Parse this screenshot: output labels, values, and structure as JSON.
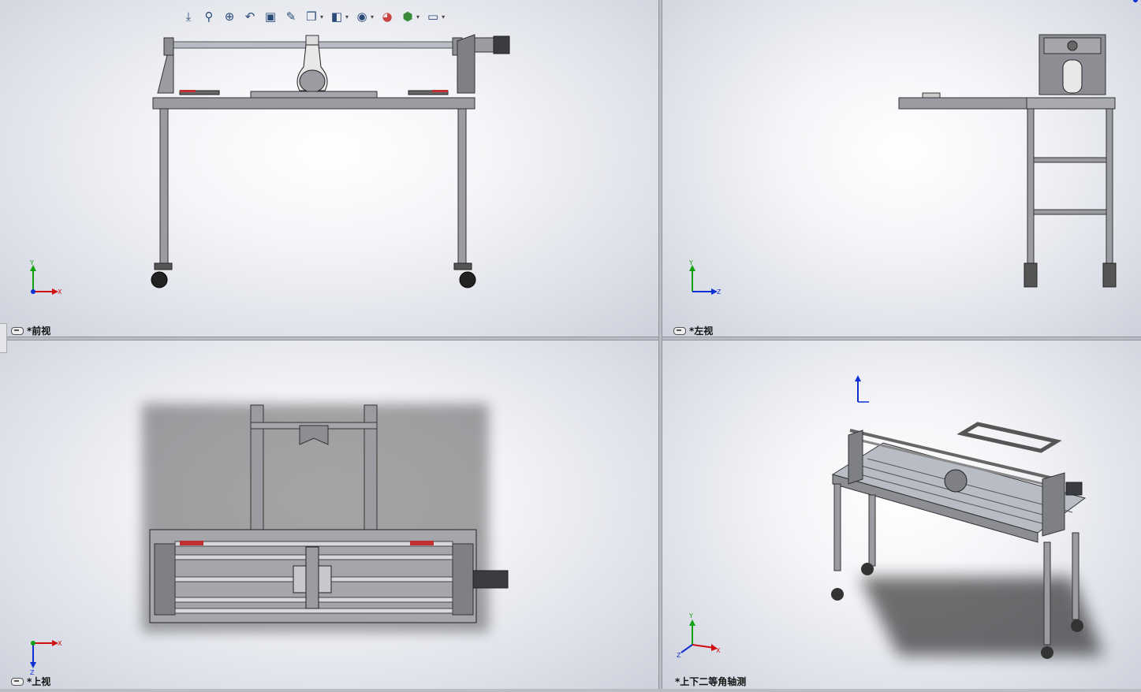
{
  "viewports": {
    "front": {
      "label": "*前视",
      "axes": {
        "up": "Y",
        "right": "X"
      }
    },
    "left": {
      "label": "*左视",
      "axes": {
        "up": "Y",
        "right": "Z"
      }
    },
    "top": {
      "label": "*上视",
      "axes": {
        "right": "X",
        "down": "Z"
      }
    },
    "iso": {
      "label": "*上下二等角轴测",
      "axes": {
        "up": "Y",
        "right": "X",
        "left": "Z"
      }
    }
  },
  "toolbar": {
    "buttons": [
      {
        "name": "view-orientation-icon",
        "glyph": "⤓"
      },
      {
        "name": "zoom-to-fit-icon",
        "glyph": "🔍"
      },
      {
        "name": "zoom-area-icon",
        "glyph": "⊕"
      },
      {
        "name": "previous-view-icon",
        "glyph": "↶"
      },
      {
        "name": "section-view-icon",
        "glyph": "▣"
      },
      {
        "name": "dynamic-annotation-icon",
        "glyph": "✎"
      },
      {
        "name": "view-orient-cube-icon",
        "glyph": "❒"
      },
      {
        "name": "display-style-icon",
        "glyph": "◧"
      },
      {
        "name": "hide-show-items-icon",
        "glyph": "◉"
      },
      {
        "name": "edit-appearance-icon",
        "glyph": "◕"
      },
      {
        "name": "apply-scene-icon",
        "glyph": "⬢"
      },
      {
        "name": "view-settings-icon",
        "glyph": "▭"
      }
    ]
  },
  "colors": {
    "frame": "#8c8e94",
    "frame_dark": "#54565c",
    "axis_x": "#d01010",
    "axis_y": "#10a010",
    "axis_z": "#1030d0"
  }
}
